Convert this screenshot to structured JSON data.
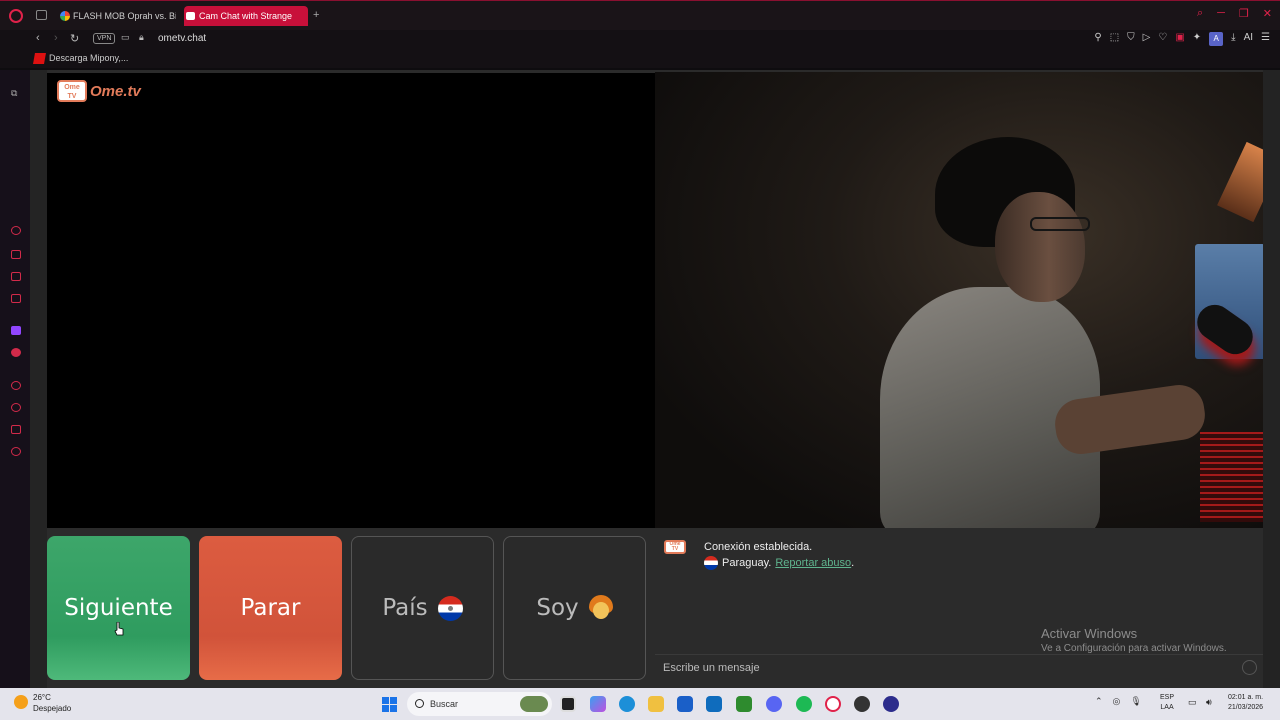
{
  "browser": {
    "tabs": [
      {
        "label": "FLASH MOB Oprah vs. Bi"
      },
      {
        "label": "Cam Chat with Strange"
      }
    ],
    "url": "ometv.chat",
    "vpn_label": "VPN",
    "toolbar_ai_label": "AI",
    "avatar_letter": "A",
    "bookmark": "Descarga Mipony,..."
  },
  "site": {
    "logo_box_text": "Ome TV",
    "logo_text": "Ome.tv"
  },
  "buttons": {
    "next": "Siguiente",
    "stop": "Parar",
    "country": "País",
    "gender": "Soy"
  },
  "chat": {
    "status": "Conexión establecida.",
    "country": "Paraguay.",
    "report": "Reportar abuso",
    "report_suffix": ".",
    "input_placeholder": "Escribe un mensaje",
    "activate_title": "Activar Windows",
    "activate_sub": "Ve a Configuración para activar Windows."
  },
  "taskbar": {
    "weather_temp": "26°C",
    "weather_desc": "Despejado",
    "search_placeholder": "Buscar",
    "lang_top": "ESP",
    "lang_bottom": "LAA",
    "time": "02:01 a. m.",
    "date": "21/03/2026"
  },
  "colors": {
    "accent": "#c8103a",
    "next_button": "#2f9c5f",
    "stop_button": "#d1533a",
    "link": "#5fb48e"
  }
}
